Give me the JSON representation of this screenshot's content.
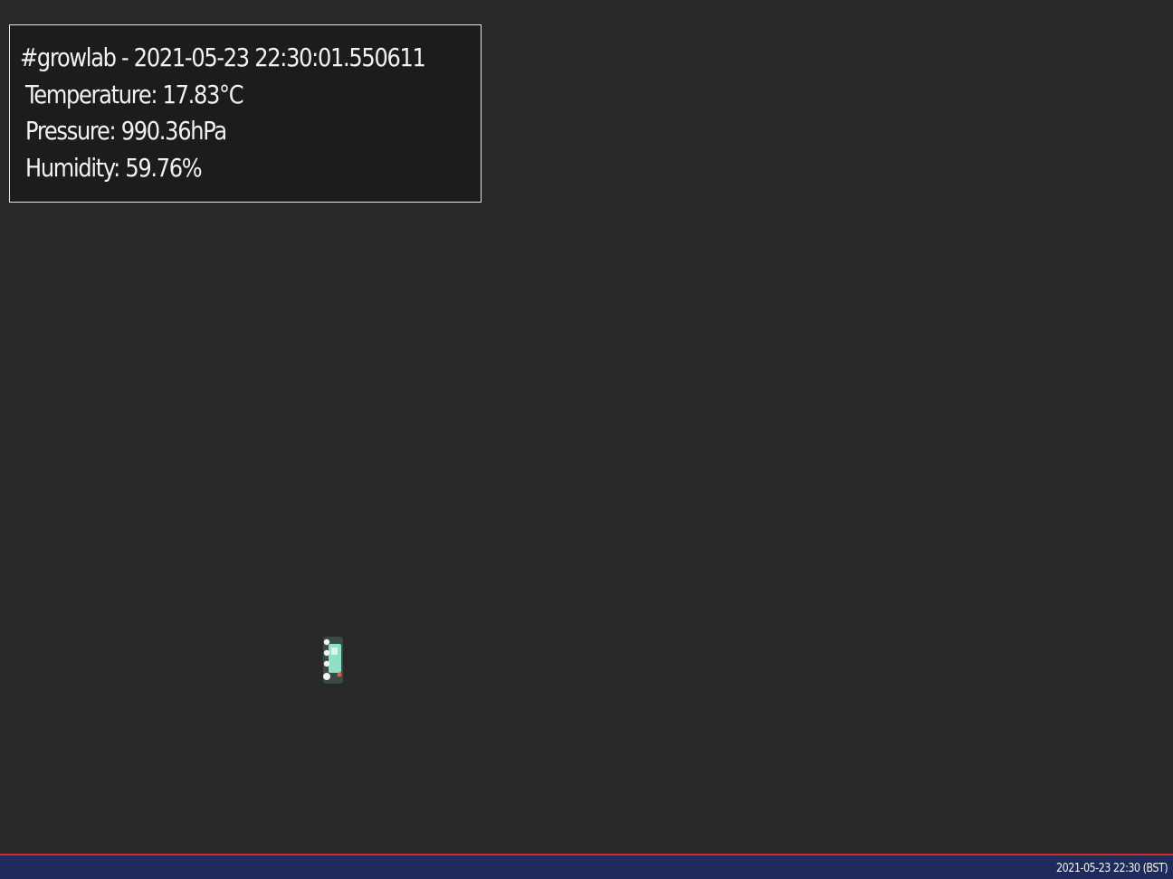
{
  "overlay": {
    "title": "#growlab - 2021-05-23 22:30:01.550611",
    "temperature": "Temperature: 17.83°C",
    "pressure": "Pressure: 990.36hPa",
    "humidity": "Humidity: 59.76%"
  },
  "footer": {
    "timestamp": "2021-05-23 22:30 (BST)"
  },
  "scene": {
    "object": "small-sensor-board"
  },
  "colors": {
    "background": "#282828",
    "overlay_bg": "#1c1c1c",
    "overlay_border": "#e6e6e6",
    "footer_bg": "#1f2b5a",
    "footer_rule": "#d42a2a"
  }
}
